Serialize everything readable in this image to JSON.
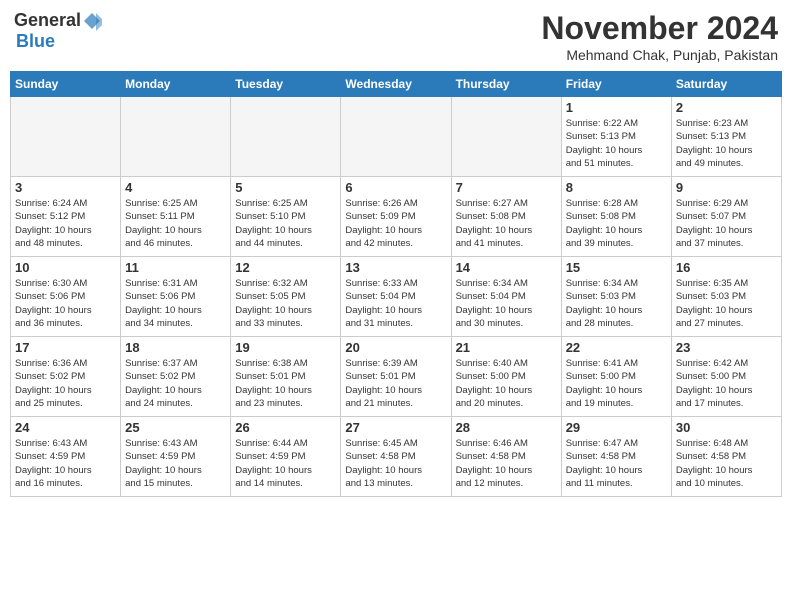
{
  "header": {
    "logo_general": "General",
    "logo_blue": "Blue",
    "month_title": "November 2024",
    "location": "Mehmand Chak, Punjab, Pakistan"
  },
  "calendar": {
    "weekdays": [
      "Sunday",
      "Monday",
      "Tuesday",
      "Wednesday",
      "Thursday",
      "Friday",
      "Saturday"
    ],
    "weeks": [
      [
        {
          "day": "",
          "info": ""
        },
        {
          "day": "",
          "info": ""
        },
        {
          "day": "",
          "info": ""
        },
        {
          "day": "",
          "info": ""
        },
        {
          "day": "",
          "info": ""
        },
        {
          "day": "1",
          "info": "Sunrise: 6:22 AM\nSunset: 5:13 PM\nDaylight: 10 hours\nand 51 minutes."
        },
        {
          "day": "2",
          "info": "Sunrise: 6:23 AM\nSunset: 5:13 PM\nDaylight: 10 hours\nand 49 minutes."
        }
      ],
      [
        {
          "day": "3",
          "info": "Sunrise: 6:24 AM\nSunset: 5:12 PM\nDaylight: 10 hours\nand 48 minutes."
        },
        {
          "day": "4",
          "info": "Sunrise: 6:25 AM\nSunset: 5:11 PM\nDaylight: 10 hours\nand 46 minutes."
        },
        {
          "day": "5",
          "info": "Sunrise: 6:25 AM\nSunset: 5:10 PM\nDaylight: 10 hours\nand 44 minutes."
        },
        {
          "day": "6",
          "info": "Sunrise: 6:26 AM\nSunset: 5:09 PM\nDaylight: 10 hours\nand 42 minutes."
        },
        {
          "day": "7",
          "info": "Sunrise: 6:27 AM\nSunset: 5:08 PM\nDaylight: 10 hours\nand 41 minutes."
        },
        {
          "day": "8",
          "info": "Sunrise: 6:28 AM\nSunset: 5:08 PM\nDaylight: 10 hours\nand 39 minutes."
        },
        {
          "day": "9",
          "info": "Sunrise: 6:29 AM\nSunset: 5:07 PM\nDaylight: 10 hours\nand 37 minutes."
        }
      ],
      [
        {
          "day": "10",
          "info": "Sunrise: 6:30 AM\nSunset: 5:06 PM\nDaylight: 10 hours\nand 36 minutes."
        },
        {
          "day": "11",
          "info": "Sunrise: 6:31 AM\nSunset: 5:06 PM\nDaylight: 10 hours\nand 34 minutes."
        },
        {
          "day": "12",
          "info": "Sunrise: 6:32 AM\nSunset: 5:05 PM\nDaylight: 10 hours\nand 33 minutes."
        },
        {
          "day": "13",
          "info": "Sunrise: 6:33 AM\nSunset: 5:04 PM\nDaylight: 10 hours\nand 31 minutes."
        },
        {
          "day": "14",
          "info": "Sunrise: 6:34 AM\nSunset: 5:04 PM\nDaylight: 10 hours\nand 30 minutes."
        },
        {
          "day": "15",
          "info": "Sunrise: 6:34 AM\nSunset: 5:03 PM\nDaylight: 10 hours\nand 28 minutes."
        },
        {
          "day": "16",
          "info": "Sunrise: 6:35 AM\nSunset: 5:03 PM\nDaylight: 10 hours\nand 27 minutes."
        }
      ],
      [
        {
          "day": "17",
          "info": "Sunrise: 6:36 AM\nSunset: 5:02 PM\nDaylight: 10 hours\nand 25 minutes."
        },
        {
          "day": "18",
          "info": "Sunrise: 6:37 AM\nSunset: 5:02 PM\nDaylight: 10 hours\nand 24 minutes."
        },
        {
          "day": "19",
          "info": "Sunrise: 6:38 AM\nSunset: 5:01 PM\nDaylight: 10 hours\nand 23 minutes."
        },
        {
          "day": "20",
          "info": "Sunrise: 6:39 AM\nSunset: 5:01 PM\nDaylight: 10 hours\nand 21 minutes."
        },
        {
          "day": "21",
          "info": "Sunrise: 6:40 AM\nSunset: 5:00 PM\nDaylight: 10 hours\nand 20 minutes."
        },
        {
          "day": "22",
          "info": "Sunrise: 6:41 AM\nSunset: 5:00 PM\nDaylight: 10 hours\nand 19 minutes."
        },
        {
          "day": "23",
          "info": "Sunrise: 6:42 AM\nSunset: 5:00 PM\nDaylight: 10 hours\nand 17 minutes."
        }
      ],
      [
        {
          "day": "24",
          "info": "Sunrise: 6:43 AM\nSunset: 4:59 PM\nDaylight: 10 hours\nand 16 minutes."
        },
        {
          "day": "25",
          "info": "Sunrise: 6:43 AM\nSunset: 4:59 PM\nDaylight: 10 hours\nand 15 minutes."
        },
        {
          "day": "26",
          "info": "Sunrise: 6:44 AM\nSunset: 4:59 PM\nDaylight: 10 hours\nand 14 minutes."
        },
        {
          "day": "27",
          "info": "Sunrise: 6:45 AM\nSunset: 4:58 PM\nDaylight: 10 hours\nand 13 minutes."
        },
        {
          "day": "28",
          "info": "Sunrise: 6:46 AM\nSunset: 4:58 PM\nDaylight: 10 hours\nand 12 minutes."
        },
        {
          "day": "29",
          "info": "Sunrise: 6:47 AM\nSunset: 4:58 PM\nDaylight: 10 hours\nand 11 minutes."
        },
        {
          "day": "30",
          "info": "Sunrise: 6:48 AM\nSunset: 4:58 PM\nDaylight: 10 hours\nand 10 minutes."
        }
      ]
    ]
  }
}
